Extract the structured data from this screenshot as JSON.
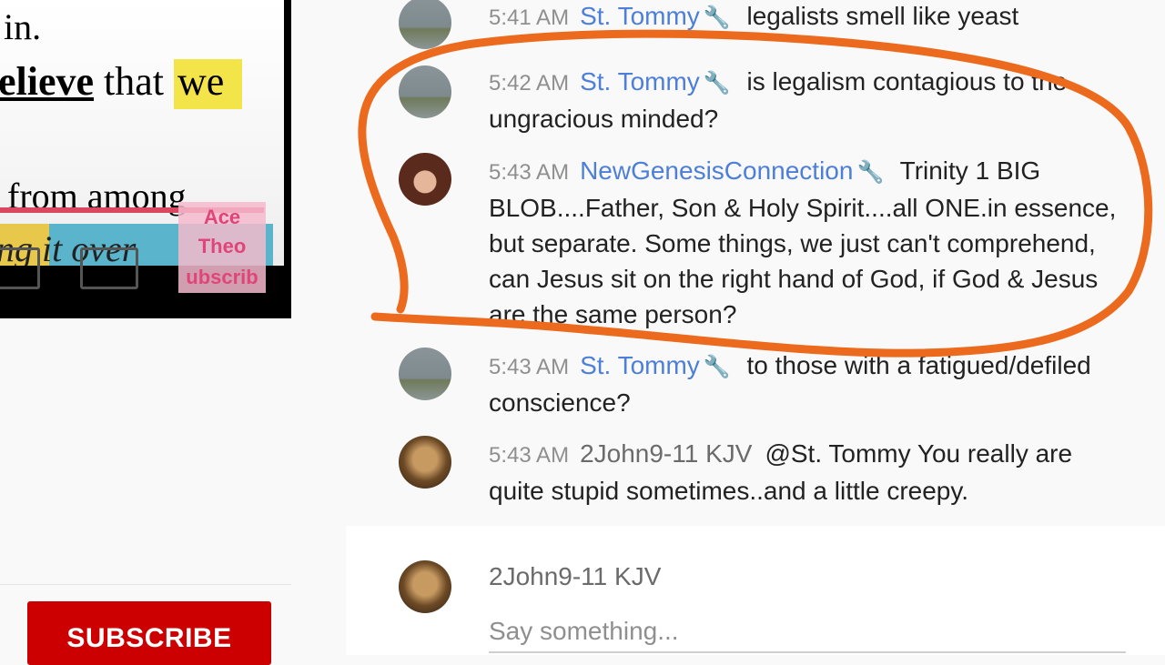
{
  "video": {
    "line1": "in.",
    "line2_bold": "elieve",
    "line2_mid": " that ",
    "line2_highlight": "we",
    "line3": "from among",
    "line4": "ng it over",
    "overlay": {
      "ace": "Ace",
      "theo": "Theo",
      "subscribe": "ubscrib"
    }
  },
  "subscribe_button": {
    "label": "SUBSCRIBE"
  },
  "chat": {
    "messages": [
      {
        "time": "5:41 AM",
        "author": "St. Tommy",
        "moderator": true,
        "text": "legalists smell like yeast",
        "avatar": "sea"
      },
      {
        "time": "5:42 AM",
        "author": "St. Tommy",
        "moderator": true,
        "text": "is legalism contagious to the ungracious minded?",
        "avatar": "sea"
      },
      {
        "time": "5:43 AM",
        "author": "NewGenesisConnection",
        "moderator": true,
        "text": "Trinity 1 BIG BLOB....Father, Son & Holy Spirit....all ONE.in essence, but separate. Some things, we just can't comprehend, can Jesus sit on the right hand of God, if God & Jesus are the same person?",
        "avatar": "woman"
      },
      {
        "time": "5:43 AM",
        "author": "St. Tommy",
        "moderator": true,
        "text": "to those with a fatigued/defiled conscience?",
        "avatar": "sea"
      },
      {
        "time": "5:43 AM",
        "author": "2John9-11 KJV",
        "moderator": false,
        "text": "@St. Tommy You really are quite stupid sometimes..and a little creepy.",
        "avatar": "skull"
      }
    ],
    "input": {
      "username": "2John9-11 KJV",
      "placeholder": "Say something..."
    }
  },
  "icons": {
    "moderator": "wrench-icon"
  },
  "colors": {
    "author": "#4d7fd9",
    "annotation": "#ec6a1d",
    "subscribe": "#cc0000"
  }
}
